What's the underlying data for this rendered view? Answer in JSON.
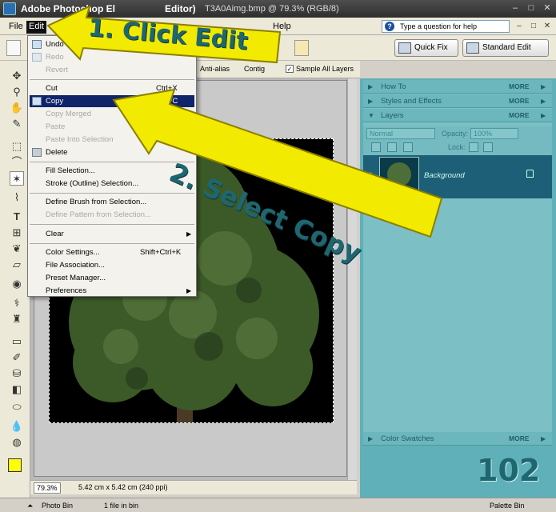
{
  "window": {
    "app_title": "Adobe Photoshop El",
    "app_title_tail": "Editor)",
    "file_title": "T3A0Aimg.bmp @ 79.3% (RGB/8)",
    "controls": [
      "–",
      "□",
      "✕"
    ]
  },
  "menubar": {
    "items": [
      "File",
      "Edit"
    ],
    "help_item": "Help",
    "help_placeholder": "Type a question for help"
  },
  "modes": {
    "quick_fix": "Quick Fix",
    "standard_edit": "Standard Edit"
  },
  "options": {
    "anti_alias": "Anti-alias",
    "sample_all": "Sample All Layers",
    "contiguous": "Contig"
  },
  "edit_menu": {
    "items": [
      {
        "label": "Undo Magic",
        "key": "",
        "state": "normal",
        "icon": "undo-icon"
      },
      {
        "label": "Redo",
        "key": "",
        "state": "disabled",
        "icon": "redo-icon"
      },
      {
        "label": "Revert",
        "key": "",
        "state": "disabled"
      },
      {
        "label": "Cut",
        "key": "Ctrl+X",
        "state": "normal"
      },
      {
        "label": "Copy",
        "key": "Ctrl+C",
        "state": "selected",
        "icon": "copy-icon"
      },
      {
        "label": "Copy Merged",
        "key": "",
        "state": "disabled"
      },
      {
        "label": "Paste",
        "key": "",
        "state": "disabled"
      },
      {
        "label": "Paste Into Selection",
        "key": "Shif",
        "state": "disabled"
      },
      {
        "label": "Delete",
        "key": "",
        "state": "normal",
        "icon": "trash-icon"
      },
      {
        "label": "Fill Selection...",
        "key": "",
        "state": "normal"
      },
      {
        "label": "Stroke (Outline) Selection...",
        "key": "",
        "state": "normal"
      },
      {
        "label": "Define Brush from Selection...",
        "key": "",
        "state": "normal"
      },
      {
        "label": "Define Pattern from Selection...",
        "key": "",
        "state": "disabled"
      },
      {
        "label": "Clear",
        "key": "",
        "state": "submenu"
      },
      {
        "label": "Color Settings...",
        "key": "Shift+Ctrl+K",
        "state": "normal"
      },
      {
        "label": "File Association...",
        "key": "",
        "state": "normal"
      },
      {
        "label": "Preset Manager...",
        "key": "",
        "state": "normal"
      },
      {
        "label": "Preferences",
        "key": "",
        "state": "submenu"
      }
    ]
  },
  "palette": {
    "panels": [
      {
        "name": "How To",
        "more": "MORE"
      },
      {
        "name": "Styles and Effects",
        "more": "MORE"
      },
      {
        "name": "Layers",
        "more": "MORE"
      }
    ],
    "blend_mode": "Normal",
    "opacity_label": "Opacity:",
    "opacity_value": "100%",
    "lock_label": "Lock:",
    "layer_name": "Background",
    "swatches": {
      "name": "Color Swatches",
      "more": "MORE"
    }
  },
  "status": {
    "zoom": "79.3%",
    "size": "5.42 cm x 5.42 cm (240 ppi)"
  },
  "bin": {
    "photo_bin": "Photo Bin",
    "files": "1 file in bin",
    "palette_bin": "Palette Bin"
  },
  "annotations": {
    "step1": "1. Click Edit",
    "step2": "2. Select Copy",
    "page_number": "102"
  },
  "colors": {
    "arrow": "#f2ea00",
    "palette_bg": "#5fb0b8",
    "menu_highlight": "#10246a",
    "foreground": "#ffff00"
  }
}
